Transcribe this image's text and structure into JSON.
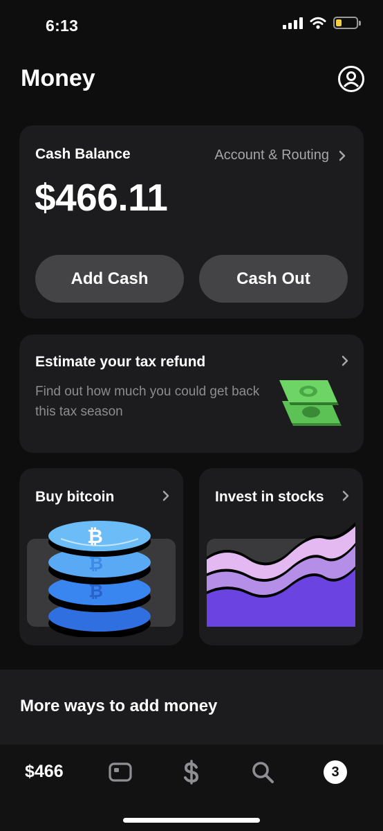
{
  "status_bar": {
    "time": "6:13"
  },
  "header": {
    "title": "Money"
  },
  "balance_card": {
    "label": "Cash Balance",
    "routing_link": "Account & Routing",
    "amount": "$466.11",
    "add_cash_label": "Add Cash",
    "cash_out_label": "Cash Out"
  },
  "tax_card": {
    "title": "Estimate your tax refund",
    "description": "Find out how much you could get back this tax season"
  },
  "bitcoin_card": {
    "title": "Buy bitcoin"
  },
  "stocks_card": {
    "title": "Invest in stocks"
  },
  "more_ways": {
    "title": "More ways to add money"
  },
  "tab_bar": {
    "balance": "$466",
    "activity_badge": "3"
  },
  "icons": [
    "signal-icon",
    "wifi-icon",
    "battery-icon",
    "profile-icon",
    "chevron-right-icon",
    "money-stack-icon",
    "bitcoin-coins-icon",
    "stocks-chart-icon",
    "card-icon",
    "dollar-icon",
    "search-icon"
  ],
  "colors": {
    "background": "#0e0e0f",
    "card": "#1c1c1e",
    "button": "#444446",
    "battery": "#f5d142",
    "money_green": "#5cc256",
    "bitcoin_blue": "#4aa3ee",
    "stocks_purple": "#6a43e0"
  },
  "battery_level": 0.3
}
